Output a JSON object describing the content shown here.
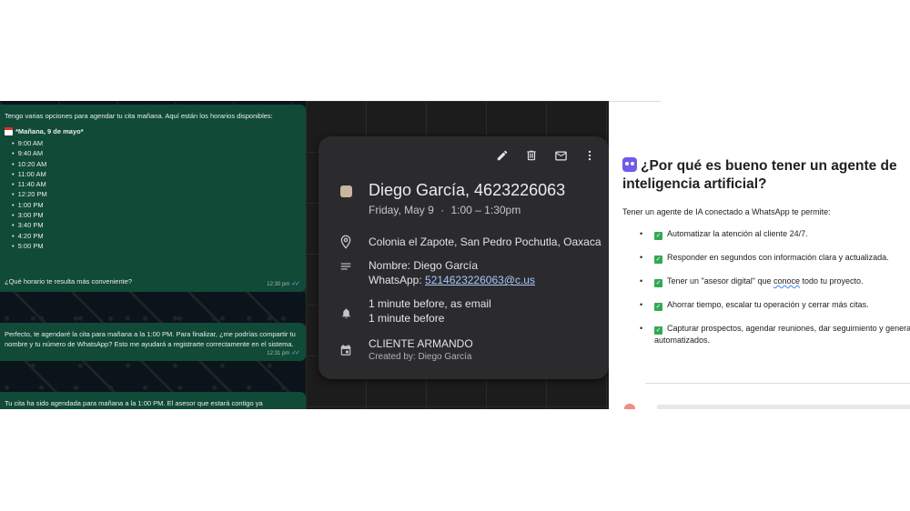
{
  "chat": {
    "message1": {
      "intro": "Tengo varias opciones para agendar tu cita mañana. Aquí están los horarios disponibles:",
      "day": "*Mañana, 9 de mayo*",
      "slots": [
        "9:00 AM",
        "9:40 AM",
        "10:20 AM",
        "11:00 AM",
        "11:40 AM",
        "12:20 PM",
        "1:00 PM",
        "3:00 PM",
        "3:40 PM",
        "4:20 PM",
        "5:00 PM"
      ],
      "question": "¿Qué horario te resulta más conveniente?",
      "time": "12:30 pm"
    },
    "message2": {
      "text": "Perfecto, te agendaré la cita para mañana a la 1:00 PM. Para finalizar, ¿me podrías compartir tu nombre y tu número de WhatsApp? Esto me ayudará a registrarte correctamente en el sistema.",
      "time": "12:31 pm"
    },
    "message3": {
      "text": "Tu cita ha sido agendada para mañana a la 1:00 PM. El asesor que estará contigo ya"
    }
  },
  "event": {
    "title": "Diego García, 4623226063",
    "date": "Friday, May 9",
    "separator": "·",
    "time_range": "1:00 – 1:30pm",
    "location": "Colonia el Zapote, San Pedro Pochutla, Oaxaca",
    "description_name": "Nombre: Diego García",
    "description_whatsapp_label": "WhatsApp: ",
    "description_whatsapp_link": "5214623226063@c.us",
    "reminder_1": "1 minute before, as email",
    "reminder_2": "1 minute before",
    "calendar_name": "CLIENTE ARMANDO",
    "created_by": "Created by: Diego García",
    "colors": {
      "swatch": "#c7b7a0",
      "card": "#2b2b2e",
      "link": "#a8c7fa"
    }
  },
  "doc": {
    "heading": "¿Por qué es bueno tener un agente de inteligencia artificial?",
    "intro": "Tener un agente de IA conectado a WhatsApp te permite:",
    "bullets": [
      "Automatizar la atención al cliente 24/7.",
      "Responder en segundos con información clara y actualizada.",
      "Ahorrar tiempo, escalar tu operación y cerrar más citas.",
      "Capturar prospectos, agendar reuniones, dar seguimiento y generar reportes automatizados."
    ],
    "bullet3_before": "Tener un \"asesor digital\" que ",
    "bullet3_underlined": "conoce",
    "bullet3_after": " todo tu proyecto."
  }
}
